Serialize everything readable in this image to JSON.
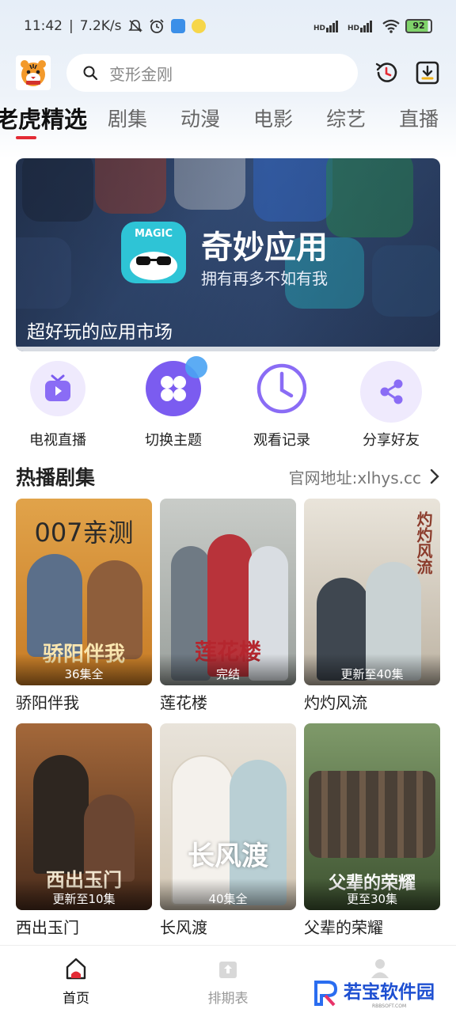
{
  "status_bar": {
    "time": "11:42",
    "speed": "7.2K/s",
    "hd1": "HD",
    "hd2": "HD",
    "battery": "92"
  },
  "header": {
    "search_placeholder": "变形金刚"
  },
  "tabs": [
    {
      "label": "老虎精选",
      "active": true
    },
    {
      "label": "剧集"
    },
    {
      "label": "动漫"
    },
    {
      "label": "电影"
    },
    {
      "label": "综艺"
    },
    {
      "label": "直播"
    }
  ],
  "banner": {
    "app_name": "奇妙应用",
    "slogan": "拥有再多不如有我",
    "icon_text": "MAGIC",
    "caption": "超好玩的应用市场"
  },
  "quick_actions": [
    {
      "label": "电视直播",
      "icon": "tv-icon"
    },
    {
      "label": "切换主题",
      "icon": "theme-icon"
    },
    {
      "label": "观看记录",
      "icon": "clock-icon"
    },
    {
      "label": "分享好友",
      "icon": "share-icon"
    }
  ],
  "section": {
    "title": "热播剧集",
    "link": "官网地址:xlhys.cc"
  },
  "shows": [
    {
      "title": "骄阳伴我",
      "badge": "36集全",
      "poster_top": "007亲测",
      "poster_text": "骄阳伴我"
    },
    {
      "title": "莲花楼",
      "badge": "完结",
      "poster_text": "莲花楼"
    },
    {
      "title": "灼灼风流",
      "badge": "更新至40集",
      "poster_text": "灼灼风流"
    },
    {
      "title": "西出玉门",
      "badge": "更新至10集",
      "poster_text": "西出玉门"
    },
    {
      "title": "长风渡",
      "badge": "40集全",
      "poster_text": "长风渡"
    },
    {
      "title": "父辈的荣耀",
      "badge": "更至30集",
      "poster_text": "父辈的荣耀"
    }
  ],
  "bottom_nav": [
    {
      "label": "首页",
      "active": true
    },
    {
      "label": "排期表"
    }
  ],
  "watermark": {
    "text": "若宝软件园",
    "sub": "RBBSOFT.COM"
  },
  "colors": {
    "accent": "#e32b35",
    "brand_blue": "#1d4fd1"
  }
}
